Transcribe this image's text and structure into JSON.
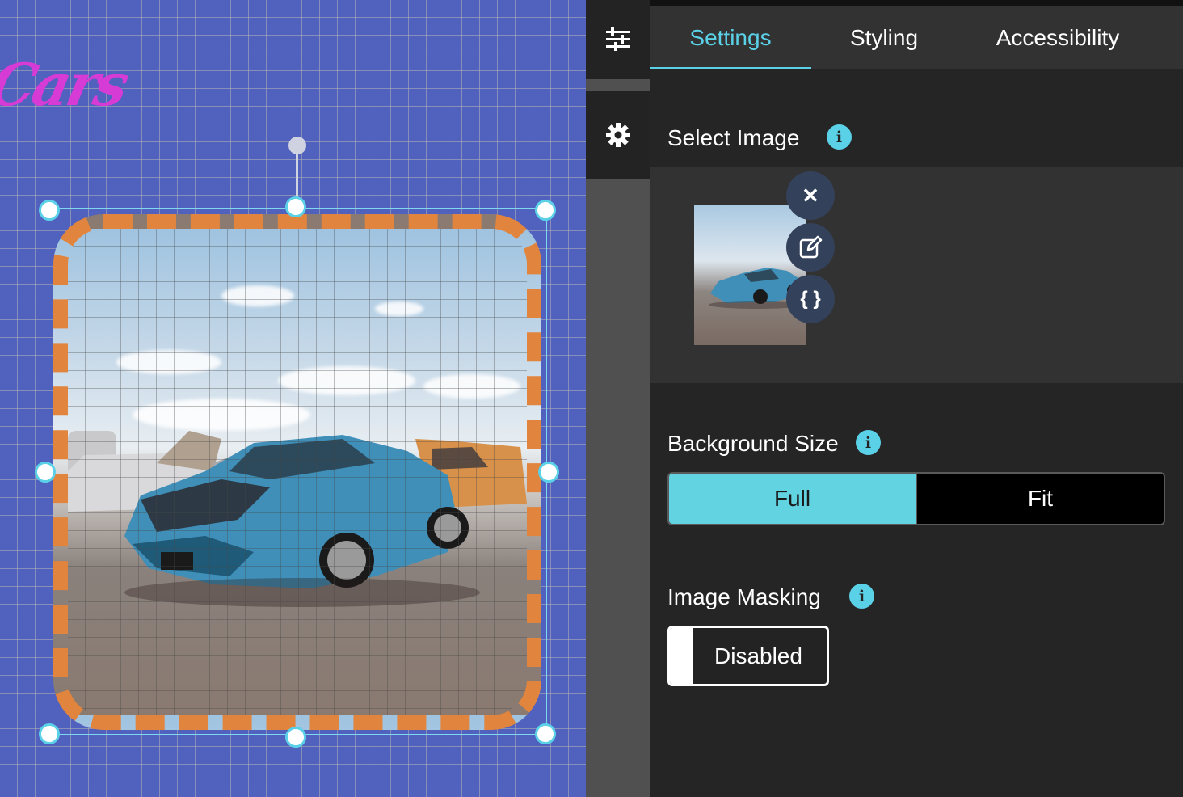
{
  "canvas": {
    "logo_text": "Cars",
    "grid_color": "#b4b4b4",
    "background": "#5161be",
    "image_border_color": "#e0843e",
    "handle_color": "#5bd1e8"
  },
  "toolbar": {
    "items": [
      {
        "icon": "sliders-icon"
      },
      {
        "icon": "gear-icon"
      }
    ]
  },
  "panel": {
    "tabs": [
      {
        "label": "Settings",
        "active": true
      },
      {
        "label": "Styling",
        "active": false
      },
      {
        "label": "Accessibility",
        "active": false
      }
    ],
    "select_image": {
      "title": "Select Image",
      "info": "i",
      "actions": {
        "remove": "✕",
        "edit": "edit-icon",
        "code": "{ }"
      }
    },
    "background_size": {
      "title": "Background Size",
      "info": "i",
      "options": [
        "Full",
        "Fit"
      ],
      "selected": "Full"
    },
    "image_masking": {
      "title": "Image Masking",
      "info": "i",
      "toggle_label": "Disabled",
      "enabled": false
    }
  },
  "colors": {
    "accent": "#5bd1e8",
    "panel_bg": "#252525",
    "panel_section_bg": "#323232"
  }
}
